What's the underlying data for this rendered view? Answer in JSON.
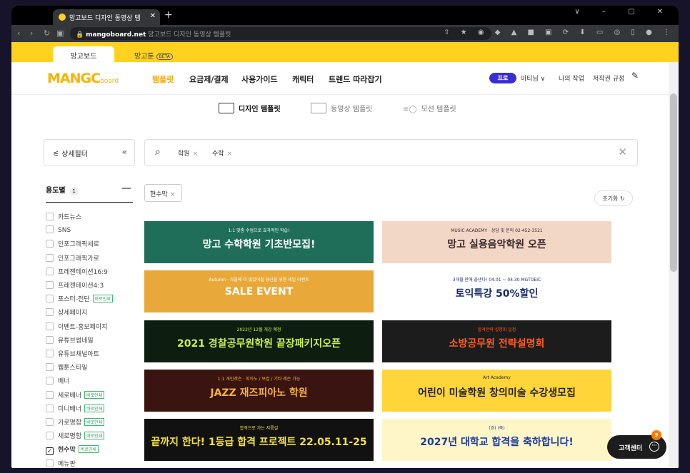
{
  "browser": {
    "tab_title": "망고보드 디자인 동영상 템",
    "url_host": "mangoboard.net",
    "url_rest": " 망고보드 디자인 동영상 템플릿"
  },
  "site_tabs": {
    "tab1": "망고보드",
    "tab2": "망고툰",
    "beta": "BETA"
  },
  "nav": {
    "logo": "MANGC",
    "logo_suffix": "board",
    "items": [
      "템플릿",
      "요금제/결제",
      "사용가이드",
      "캐릭터",
      "트렌드 따라잡기"
    ],
    "pro": "프로",
    "user": "아티님 ∨",
    "my_work": "나의 작업",
    "copyright": "저작권 규정"
  },
  "subnav": [
    "디자인 템플릿",
    "동영상 템플릿",
    "모션 템플릿"
  ],
  "filter": {
    "label": "상세필터",
    "collapse": "«"
  },
  "search": {
    "chips": [
      "학원",
      "수학"
    ]
  },
  "sidebar": {
    "heading": "용도별",
    "count": "1",
    "items": [
      {
        "label": "카드뉴스",
        "badge": ""
      },
      {
        "label": "SNS",
        "badge": ""
      },
      {
        "label": "인포그래픽세로",
        "badge": ""
      },
      {
        "label": "인포그래픽가로",
        "badge": ""
      },
      {
        "label": "프레젠테이션16:9",
        "badge": ""
      },
      {
        "label": "프레젠테이션4:3",
        "badge": ""
      },
      {
        "label": "포스터-전단",
        "badge": "바로인쇄"
      },
      {
        "label": "상세페이지",
        "badge": ""
      },
      {
        "label": "이벤트-홍보페이지",
        "badge": ""
      },
      {
        "label": "유튜브썸네일",
        "badge": ""
      },
      {
        "label": "유튜브채널아트",
        "badge": ""
      },
      {
        "label": "웹툰스타일",
        "badge": ""
      },
      {
        "label": "배너",
        "badge": ""
      },
      {
        "label": "세로배너",
        "badge": "바로인쇄"
      },
      {
        "label": "미니배너",
        "badge": "바로인쇄"
      },
      {
        "label": "가로명함",
        "badge": "바로인쇄"
      },
      {
        "label": "세로명함",
        "badge": "바로인쇄"
      },
      {
        "label": "현수막",
        "badge": "바로인쇄",
        "checked": true
      },
      {
        "label": "메뉴판",
        "badge": ""
      }
    ]
  },
  "applied_tag": "현수막",
  "reset": "초기화",
  "templates": [
    {
      "title": "망고 수학학원 기초반모집!",
      "sub": "1:1 맞춤 수업으로 효과적인 학습!",
      "bg": "#1f6e5a",
      "fg": "#ffffff"
    },
    {
      "title": "망고 실용음악학원 오픈",
      "sub": "MUSIC ACADEMY · 상담 및 문의 02-452-3521",
      "bg": "#f2d6c6",
      "fg": "#3a2a2a"
    },
    {
      "title": "SALE EVENT",
      "sub": "Autumn · 가을에 더 멋있어질 당신을 위한 세일 이벤트",
      "bg": "#e8a93a",
      "fg": "#ffffff"
    },
    {
      "title": "토익특강 50%할인",
      "sub": "3개월 만에 끝낸다! 04.01 ~ 04.30 MGTOEIC",
      "bg": "#ffffff",
      "fg": "#1b2c6b"
    },
    {
      "title": "2021 경찰공무원학원 끝장패키지오픈",
      "sub": "2022년 12월 개강 예정",
      "bg": "#0d1d10",
      "fg": "#c6f04a"
    },
    {
      "title": "소방공무원 전략설명회",
      "sub": "합격전략 설명회 일정",
      "bg": "#1c1c1c",
      "fg": "#ff5a1f"
    },
    {
      "title": "JAZZ 재즈피아노 학원",
      "sub": "1:1 개인레슨 · 피아노 / 보컬 / 기타 레슨 가능",
      "bg": "#3a1410",
      "fg": "#f3b33c"
    },
    {
      "title": "어린이 미술학원 창의미술 수강생모집",
      "sub": "Art Academy",
      "bg": "#ffd53a",
      "fg": "#222222"
    },
    {
      "title": "끝까지 한다! 1등급 합격 프로젝트 22.05.11-25",
      "sub": "합격으로 가는 지름길",
      "bg": "#111111",
      "fg": "#f5e23a"
    },
    {
      "title": "2027년 대학교 합격을 축하합니다!",
      "sub": "(경) (축)",
      "bg": "#fff6c8",
      "fg": "#1b3b9c"
    }
  ],
  "cs": {
    "label": "고객센터",
    "count": "9"
  }
}
